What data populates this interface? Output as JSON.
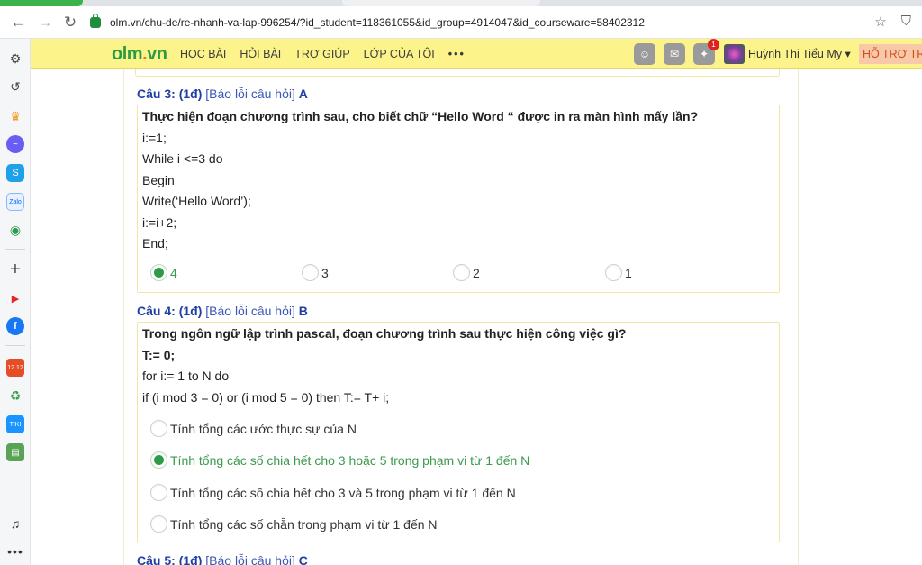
{
  "browser": {
    "url": "olm.vn/chu-de/re-nhanh-va-lap-996254/?id_student=118361055&id_group=4914047&id_courseware=58402312",
    "back_icon": "arrow-left-icon",
    "forward_icon": "arrow-right-icon",
    "reload_icon": "reload-icon"
  },
  "site": {
    "logo_main": "olm",
    "logo_dot": ".",
    "logo_tld": "vn",
    "menu": [
      "HỌC BÀI",
      "HỎI BÀI",
      "TRỢ GIÚP",
      "LỚP CỦA TÔI",
      "•••"
    ],
    "notification_count": "1",
    "username": "Huỳnh Thị Tiểu My ▾",
    "support_label": "HỖ TRỢ TR"
  },
  "questions": [
    {
      "number": "Câu 3:",
      "points": "(1đ)",
      "report": "[Báo lỗi câu hỏi]",
      "answer": "A",
      "lines": [
        {
          "text": "Thực hiện đoạn chương trình sau, cho biết chữ “Hello Word “ được in ra màn hình mấy lần?",
          "bold": true
        },
        {
          "text": "i:=1;",
          "bold": false
        },
        {
          "text": "While i <=3 do",
          "bold": false
        },
        {
          "text": "Begin",
          "bold": false
        },
        {
          "text": "Write(‘Hello Word’);",
          "bold": false
        },
        {
          "text": "i:=i+2;",
          "bold": false
        },
        {
          "text": "End;",
          "bold": false
        }
      ],
      "options": [
        {
          "label": "4",
          "selected": true
        },
        {
          "label": "3",
          "selected": false
        },
        {
          "label": "2",
          "selected": false
        },
        {
          "label": "1",
          "selected": false
        }
      ]
    },
    {
      "number": "Câu 4:",
      "points": "(1đ)",
      "report": "[Báo lỗi câu hỏi]",
      "answer": "B",
      "lines": [
        {
          "text": "Trong ngôn ngữ lập trình pascal, đoạn chương trình sau thực hiện công việc gì?",
          "bold": true
        },
        {
          "text": "T:= 0;",
          "bold": true
        },
        {
          "text": "for i:= 1 to N do",
          "bold": false
        },
        {
          "text": "if (i mod 3 = 0) or (i mod 5 = 0) then T:= T+ i;",
          "bold": false
        }
      ],
      "options": [
        {
          "label": "Tính tổng các ước thực sự của N",
          "selected": false
        },
        {
          "label": "Tính tổng các số chia hết cho 3 hoặc 5 trong phạm vi từ 1 đến N",
          "selected": true
        },
        {
          "label": "Tính tổng các số chia hết cho 3 và 5 trong phạm vi từ 1 đến N",
          "selected": false
        },
        {
          "label": "Tính tổng các số chẵn trong phạm vi từ 1 đến N",
          "selected": false
        }
      ]
    }
  ],
  "next_question": {
    "number": "Câu 5:",
    "points": "(1đ)",
    "report": "[Báo lỗi câu hỏi]",
    "answer": "C"
  },
  "colors": {
    "header_bg": "#fdf38b",
    "logo_green": "#2b9b44",
    "question_blue": "#1f3fa5",
    "selected_green": "#2e9b49",
    "box_border": "#f3e6a2"
  }
}
